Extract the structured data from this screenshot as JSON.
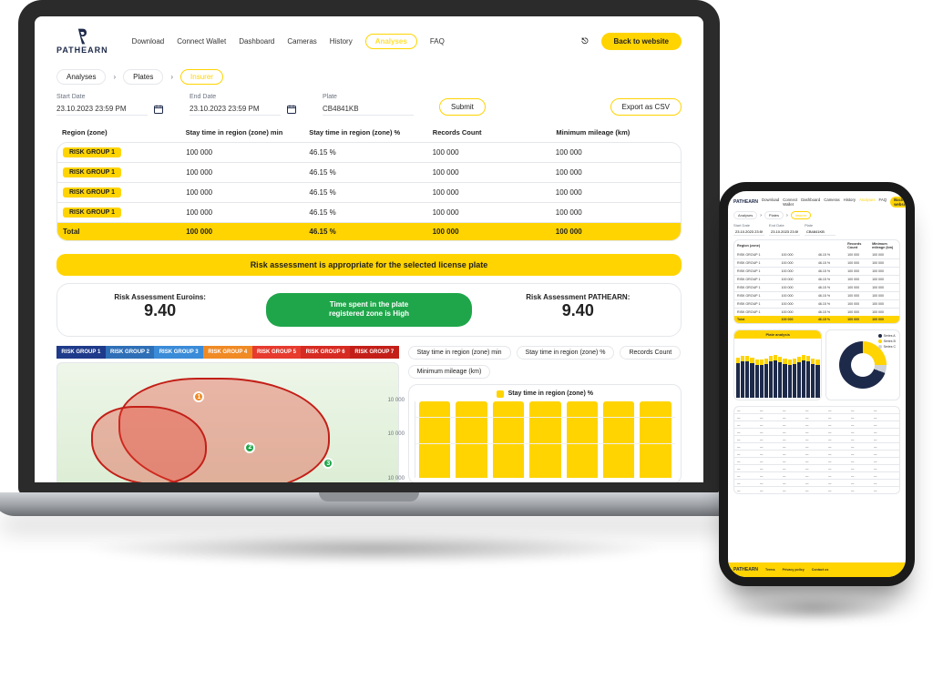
{
  "brand": {
    "name": "PATHEARN"
  },
  "nav": {
    "download": "Download",
    "connect_wallet": "Connect Wallet",
    "dashboard": "Dashboard",
    "cameras": "Cameras",
    "history": "History",
    "analyses": "Analyses",
    "faq": "FAQ",
    "back_to_website": "Back to website"
  },
  "breadcrumb": {
    "a": "Analyses",
    "b": "Plates",
    "c": "Insurer"
  },
  "filters": {
    "start_label": "Start Date",
    "start_value": "23.10.2023 23:59 PM",
    "end_label": "End Date",
    "end_value": "23.10.2023 23:59 PM",
    "plate_label": "Plate",
    "plate_value": "CB4841KB",
    "submit": "Submit",
    "export": "Export as CSV"
  },
  "table": {
    "head": {
      "region": "Region (zone)",
      "stay_min": "Stay time in region (zone) min",
      "stay_pct": "Stay time in region (zone) %",
      "records": "Records Count",
      "mileage": "Minimum mileage (km)"
    },
    "rows": [
      {
        "region": "RISK GROUP 1",
        "stay_min": "100 000",
        "stay_pct": "46.15 %",
        "records": "100 000",
        "mileage": "100 000"
      },
      {
        "region": "RISK GROUP 1",
        "stay_min": "100 000",
        "stay_pct": "46.15 %",
        "records": "100 000",
        "mileage": "100 000"
      },
      {
        "region": "RISK GROUP 1",
        "stay_min": "100 000",
        "stay_pct": "46.15 %",
        "records": "100 000",
        "mileage": "100 000"
      },
      {
        "region": "RISK GROUP 1",
        "stay_min": "100 000",
        "stay_pct": "46.15 %",
        "records": "100 000",
        "mileage": "100 000"
      }
    ],
    "total": {
      "label": "Total",
      "stay_min": "100 000",
      "stay_pct": "46.15 %",
      "records": "100 000",
      "mileage": "100 000"
    }
  },
  "banner": "Risk assessment is appropriate for the selected license plate",
  "assessment": {
    "left_label": "Risk Assessment Euroins:",
    "left_score": "9.40",
    "mid_line1": "Time spent in the plate",
    "mid_line2": "registered zone is High",
    "right_label": "Risk Assessment PATHEARN:",
    "right_score": "9.40"
  },
  "map_legend": {
    "g1": "RISK GROUP 1",
    "g2": "RISK GROUP 2",
    "g3": "RISK GROUP 3",
    "g4": "RISK GROUP 4",
    "g5": "RISK GROUP 5",
    "g6": "RISK GROUP 6",
    "g7": "RISK GROUP 7"
  },
  "chips": {
    "c1": "Stay time in region (zone) min",
    "c2": "Stay time in region (zone) %",
    "c3": "Records Count",
    "c4": "Minimum mileage (km)"
  },
  "chart_title": "Stay time in region (zone) %",
  "chart_data": {
    "type": "bar",
    "title": "Stay time in region (zone) %",
    "categories": [
      "",
      "",
      "",
      "",
      "",
      "",
      ""
    ],
    "values": [
      10000,
      10000,
      10000,
      10000,
      10000,
      10000,
      10000
    ],
    "ylabel": "",
    "ylim": [
      0,
      10000
    ],
    "yticks": [
      "10 000",
      "10 000",
      "10 000"
    ]
  },
  "phone": {
    "donut_legend": {
      "a": "Series A",
      "b": "Series B",
      "c": "Series C"
    },
    "footer": {
      "a": "Terms",
      "b": "Privacy policy",
      "c": "Contact us"
    },
    "bar_title": "Plate analysis"
  }
}
